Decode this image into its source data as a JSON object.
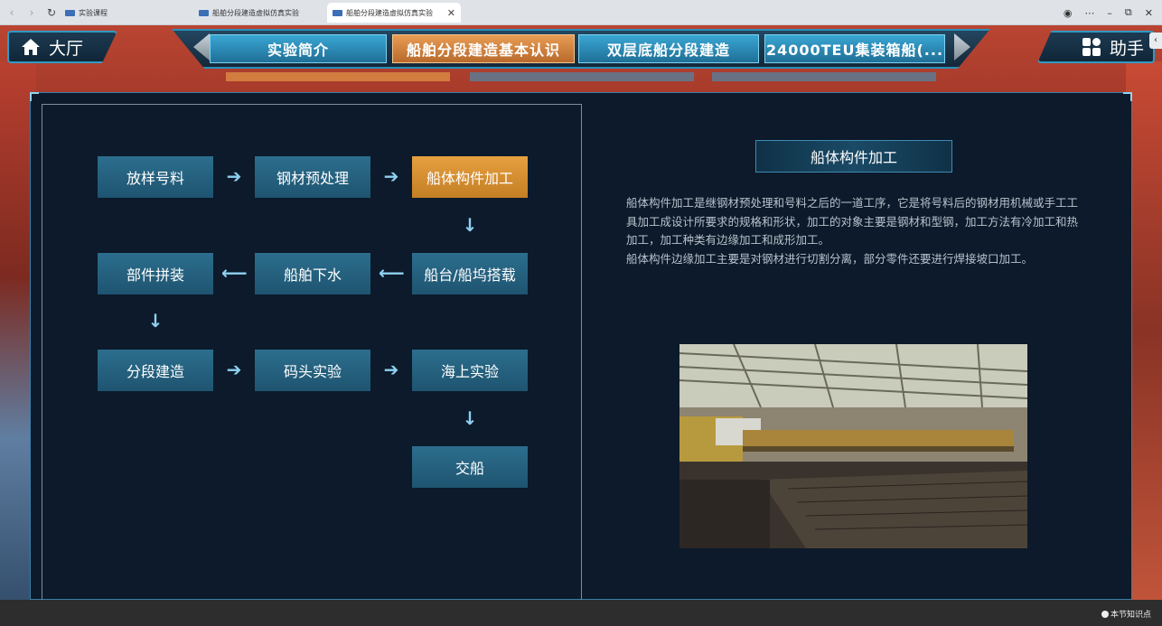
{
  "browser": {
    "tabs": [
      {
        "title": "实验课程"
      },
      {
        "title": "船舶分段建造虚拟仿真实验"
      },
      {
        "title": "船舶分段建造虚拟仿真实验",
        "active": true
      }
    ],
    "close_glyph": "✕",
    "menu_glyph": "⋯"
  },
  "header": {
    "hall_label": "大厅",
    "helper_label": "助手",
    "tabs": [
      {
        "label": "实验简介"
      },
      {
        "label": "船舶分段建造基本认识",
        "active": true
      },
      {
        "label": "双层底船分段建造"
      },
      {
        "label": "24000TEU集装箱船(..."
      }
    ]
  },
  "flow": {
    "nodes": [
      {
        "label": "放样号料"
      },
      {
        "label": "钢材预处理"
      },
      {
        "label": "船体构件加工",
        "active": true
      },
      {
        "label": "船台/船坞搭载"
      },
      {
        "label": "船舶下水"
      },
      {
        "label": "部件拼装"
      },
      {
        "label": "分段建造"
      },
      {
        "label": "码头实验"
      },
      {
        "label": "海上实验"
      },
      {
        "label": "交船"
      }
    ],
    "arrows": {
      "right": "➔",
      "left": "⟵",
      "down": "↓"
    }
  },
  "detail": {
    "title": "船体构件加工",
    "paragraphs": [
      "船体构件加工是继钢材预处理和号料之后的一道工序，它是将号料后的钢材用机械或手工工具加工成设计所要求的规格和形状，加工的对象主要是钢材和型钢，加工方法有冷加工和热加工，加工种类有边缘加工和成形加工。",
      "船体构件边缘加工主要是对钢材进行切割分离，部分零件还要进行焊接坡口加工。"
    ]
  },
  "footer": {
    "knowledge_label": "本节知识点"
  },
  "colors": {
    "accent_blue": "#2c6e8e",
    "accent_orange": "#e6a040",
    "panel_bg": "#0c1a2b"
  }
}
